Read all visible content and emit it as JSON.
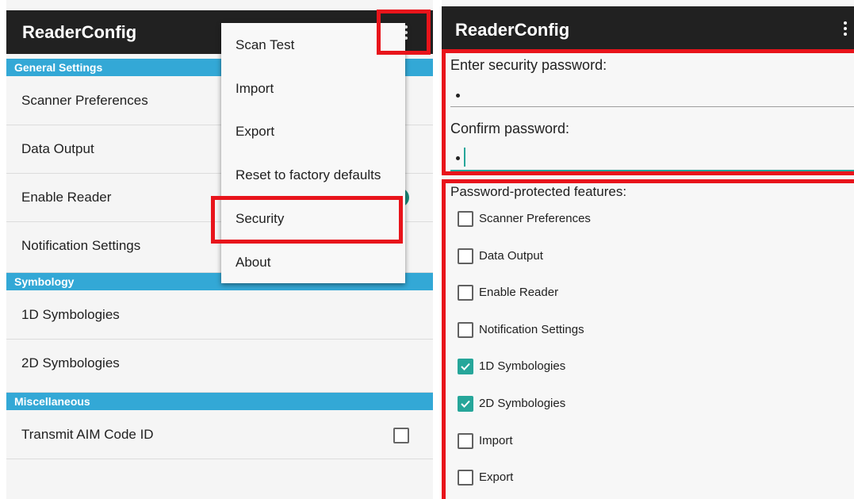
{
  "left_screen": {
    "app_title": "ReaderConfig",
    "sections": [
      {
        "label": "General Settings",
        "items": [
          "Scanner Preferences",
          "Data Output",
          "Enable Reader",
          "Notification Settings"
        ]
      },
      {
        "label": "Symbology",
        "items": [
          "1D Symbologies",
          "2D Symbologies"
        ]
      },
      {
        "label": "Miscellaneous",
        "items": [
          "Transmit AIM Code ID"
        ]
      }
    ],
    "enable_reader_on": true,
    "transmit_aim_checked": false,
    "overflow_menu": [
      "Scan Test",
      "Import",
      "Export",
      "Reset to factory defaults",
      "Security",
      "About"
    ],
    "highlighted_menu_item": "Security"
  },
  "right_screen": {
    "app_title": "ReaderConfig",
    "password_label": "Enter security password:",
    "password_value": "•",
    "confirm_label": "Confirm password:",
    "confirm_value": "•",
    "features_label": "Password-protected features:",
    "features": [
      {
        "label": "Scanner Preferences",
        "checked": false
      },
      {
        "label": "Data Output",
        "checked": false
      },
      {
        "label": "Enable Reader",
        "checked": false
      },
      {
        "label": "Notification Settings",
        "checked": false
      },
      {
        "label": "1D Symbologies",
        "checked": true
      },
      {
        "label": "2D Symbologies",
        "checked": true
      },
      {
        "label": "Import",
        "checked": false
      },
      {
        "label": "Export",
        "checked": false
      }
    ]
  },
  "colors": {
    "app_bar": "#212121",
    "section_header": "#33a8d6",
    "accent": "#26a69a",
    "highlight": "#e8141b"
  },
  "icons": {
    "overflow": "more-vert-icon",
    "checkbox": "checkbox-icon",
    "check": "check-icon"
  }
}
